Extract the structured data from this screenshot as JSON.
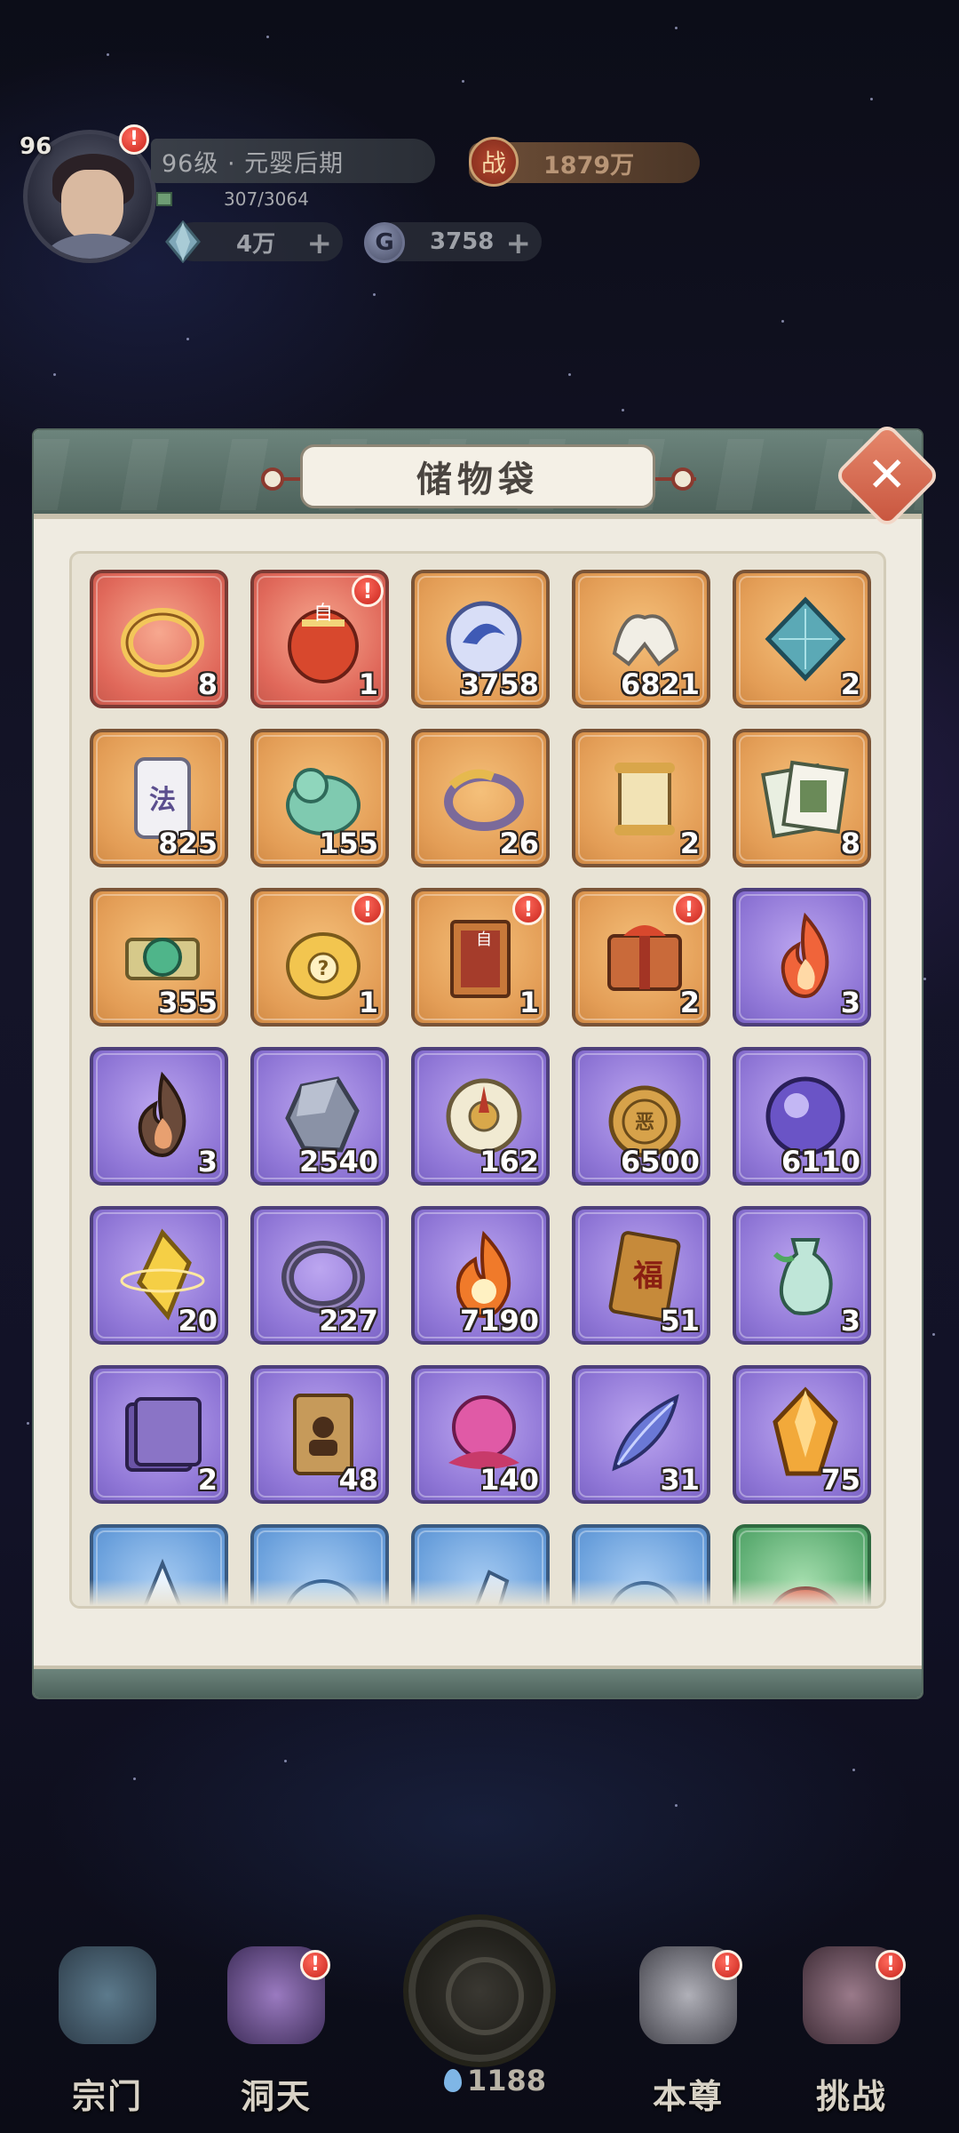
{
  "player": {
    "level_badge": "96",
    "rank": "96级 · 元婴后期",
    "exp": "307/3064",
    "power_icon": "战",
    "power": "1879万",
    "spirit_stones": "4万",
    "coins": "3758",
    "coin_icon": "G",
    "alert": "!"
  },
  "modal": {
    "title": "储物袋",
    "close": "✕"
  },
  "items": [
    {
      "name": "golden-ring",
      "count": "8",
      "quality": "red",
      "alert": false,
      "icon": "ring"
    },
    {
      "name": "red-lucky-bag",
      "count": "1",
      "quality": "red",
      "alert": true,
      "icon": "bag-red"
    },
    {
      "name": "blue-spirit-orb",
      "count": "3758",
      "quality": "orange",
      "alert": false,
      "icon": "coin-blue"
    },
    {
      "name": "white-claw",
      "count": "6821",
      "quality": "orange",
      "alert": false,
      "icon": "claw"
    },
    {
      "name": "teal-crystal",
      "count": "2",
      "quality": "orange",
      "alert": false,
      "icon": "crystal"
    },
    {
      "name": "law-talisman",
      "count": "825",
      "quality": "orange",
      "alert": false,
      "icon": "talisman",
      "glyph": "法"
    },
    {
      "name": "jade-lion",
      "count": "155",
      "quality": "orange",
      "alert": false,
      "icon": "lion"
    },
    {
      "name": "golden-bracelet",
      "count": "26",
      "quality": "orange",
      "alert": false,
      "icon": "bracelet"
    },
    {
      "name": "scroll",
      "count": "2",
      "quality": "orange",
      "alert": false,
      "icon": "scroll"
    },
    {
      "name": "book-pages",
      "count": "8",
      "quality": "orange",
      "alert": false,
      "icon": "pages"
    },
    {
      "name": "jade-scroll",
      "count": "355",
      "quality": "orange",
      "alert": false,
      "icon": "jade-scroll"
    },
    {
      "name": "mystery-bag",
      "count": "1",
      "quality": "orange",
      "alert": true,
      "icon": "mystery"
    },
    {
      "name": "red-book",
      "count": "1",
      "quality": "orange",
      "alert": true,
      "icon": "book-red"
    },
    {
      "name": "gift-pack",
      "count": "2",
      "quality": "orange",
      "alert": true,
      "icon": "gift"
    },
    {
      "name": "red-flame",
      "count": "3",
      "quality": "purple",
      "alert": false,
      "icon": "flame-red"
    },
    {
      "name": "dark-flame",
      "count": "3",
      "quality": "purple",
      "alert": false,
      "icon": "flame-dark"
    },
    {
      "name": "iron-ore",
      "count": "2540",
      "quality": "purple",
      "alert": false,
      "icon": "ore"
    },
    {
      "name": "compass-disc",
      "count": "162",
      "quality": "purple",
      "alert": false,
      "icon": "compass"
    },
    {
      "name": "evil-token",
      "count": "6500",
      "quality": "purple",
      "alert": false,
      "icon": "token"
    },
    {
      "name": "purple-orb",
      "count": "6110",
      "quality": "purple",
      "alert": false,
      "icon": "orb"
    },
    {
      "name": "golden-shard",
      "count": "20",
      "quality": "purple",
      "alert": false,
      "icon": "shard"
    },
    {
      "name": "dark-ring",
      "count": "227",
      "quality": "purple",
      "alert": false,
      "icon": "dark-ring"
    },
    {
      "name": "fire-essence",
      "count": "7190",
      "quality": "purple",
      "alert": false,
      "icon": "fire-ess"
    },
    {
      "name": "fortune-ticket",
      "count": "51",
      "quality": "purple",
      "alert": false,
      "icon": "ticket",
      "glyph": "福"
    },
    {
      "name": "jade-vase",
      "count": "3",
      "quality": "purple",
      "alert": false,
      "icon": "vase"
    },
    {
      "name": "purple-tome",
      "count": "2",
      "quality": "purple",
      "alert": false,
      "icon": "tome"
    },
    {
      "name": "portrait-card",
      "count": "48",
      "quality": "purple",
      "alert": false,
      "icon": "card"
    },
    {
      "name": "rose-orb",
      "count": "140",
      "quality": "purple",
      "alert": false,
      "icon": "rose-orb"
    },
    {
      "name": "spirit-feather",
      "count": "31",
      "quality": "purple",
      "alert": false,
      "icon": "feather"
    },
    {
      "name": "amber-crystal",
      "count": "75",
      "quality": "purple",
      "alert": false,
      "icon": "amber"
    },
    {
      "name": "ice-crystal",
      "count": "",
      "quality": "blue",
      "alert": false,
      "icon": "ice"
    },
    {
      "name": "water-spirit",
      "count": "",
      "quality": "blue",
      "alert": false,
      "icon": "water"
    },
    {
      "name": "frost-blade",
      "count": "",
      "quality": "blue",
      "alert": false,
      "icon": "blade"
    },
    {
      "name": "blue-rose",
      "count": "",
      "quality": "blue",
      "alert": false,
      "icon": "rose"
    },
    {
      "name": "red-beast",
      "count": "",
      "quality": "green",
      "alert": false,
      "icon": "beast"
    }
  ],
  "nav": [
    {
      "label": "宗门",
      "alert": false,
      "color": "#4a6a80"
    },
    {
      "label": "洞天",
      "alert": true,
      "color": "#7a5aa0"
    },
    {
      "label": "本尊",
      "alert": true,
      "color": "#8a8a92"
    },
    {
      "label": "挑战",
      "alert": true,
      "color": "#7a5a6a"
    }
  ],
  "center": {
    "count": "1188"
  },
  "colors": {
    "panel": "#efebe1",
    "panel_frame": "#5a7068",
    "badge_red": "#d3362a"
  }
}
